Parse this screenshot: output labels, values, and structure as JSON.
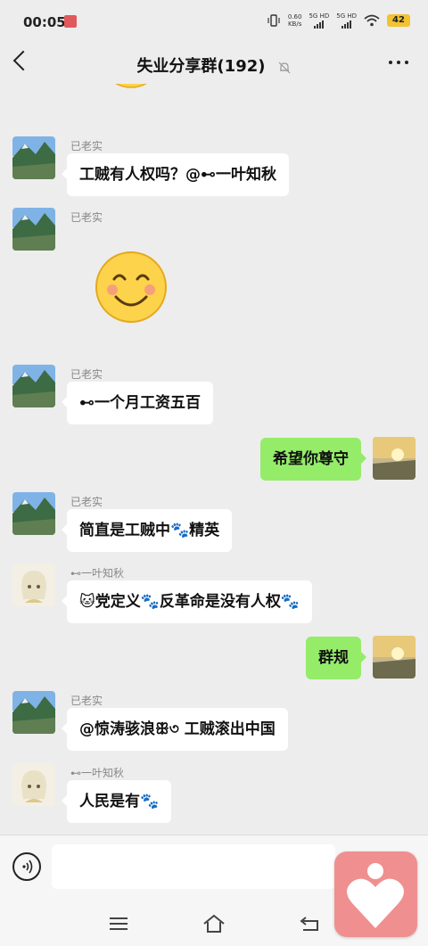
{
  "status_bar": {
    "time": "00:05",
    "network_speed": "0.60",
    "network_unit": "KB/s",
    "sim1": "5G HD",
    "sim2": "5G HD",
    "battery": "42"
  },
  "header": {
    "title": "失业分享群(192)"
  },
  "messages": [
    {
      "sender": "已老实",
      "text": "工贼有人权吗？@⊷一叶知秋"
    },
    {
      "sender": "已老实"
    },
    {
      "sender": "已老实",
      "text": "⊷一个月工资五百"
    },
    {
      "text": "希望你尊守"
    },
    {
      "sender": "已老实",
      "text": "简直是工贼中🐾精英"
    },
    {
      "sender": "⊷一叶知秋",
      "text": "🐱党定义🐾反革命是没有人权🐾"
    },
    {
      "text": "群规"
    },
    {
      "sender": "已老实",
      "text": "@惊涛骇浪ꕥ৩ 工贼滚出中国"
    },
    {
      "sender": "⊷一叶知秋",
      "text": "人民是有🐾"
    }
  ],
  "input": {
    "value": "",
    "placeholder": ""
  },
  "colors": {
    "background": "#ededed",
    "bubble_self": "#95ec69",
    "bubble_other": "#ffffff",
    "floating_app": "#f08f8f"
  },
  "icons": [
    "back-icon",
    "mute-bell-icon",
    "more-icon",
    "voice-icon",
    "menu-icon",
    "home-icon",
    "back-nav-icon",
    "heart-icon"
  ]
}
